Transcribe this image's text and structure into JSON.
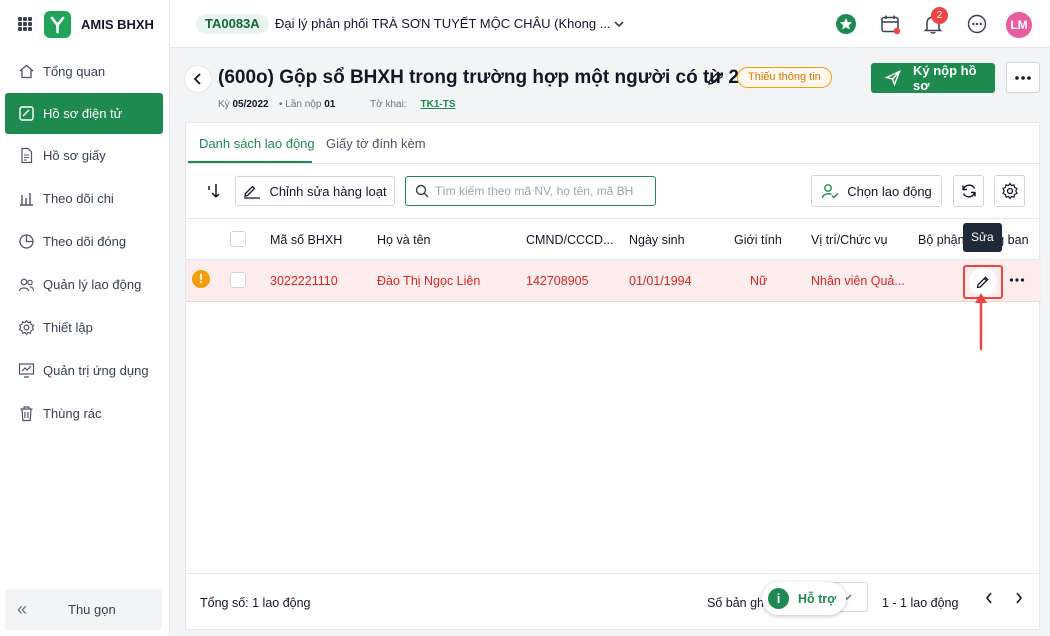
{
  "app": {
    "name": "AMIS BHXH"
  },
  "sidebar": {
    "items": [
      {
        "label": "Tổng quan",
        "icon": "home-icon"
      },
      {
        "label": "Hồ sơ điện tử",
        "icon": "e-file-icon",
        "active": true
      },
      {
        "label": "Hồ sơ giấy",
        "icon": "paper-file-icon"
      },
      {
        "label": "Theo dõi chi",
        "icon": "bar-chart-icon"
      },
      {
        "label": "Theo dõi đóng",
        "icon": "pie-chart-icon"
      },
      {
        "label": "Quản lý lao động",
        "icon": "users-icon"
      },
      {
        "label": "Thiết lập",
        "icon": "settings-icon"
      },
      {
        "label": "Quản trị ứng dụng",
        "icon": "admin-chart-icon"
      },
      {
        "label": "Thùng rác",
        "icon": "trash-icon"
      }
    ],
    "collapse_label": "Thu gọn"
  },
  "topbar": {
    "unit_code": "TA0083A",
    "unit_name": "Đại lý phân phối TRÀ SƠN TUYẾT MỘC CHÂU (Khong ...",
    "notification_count": "2",
    "avatar_initials": "LM"
  },
  "header": {
    "title": "(600o) Gộp sổ BHXH trong trường hợp một người có từ 2 sổ ...",
    "status": "Thiếu thông tin",
    "submit_label": "Ký nộp hồ sơ",
    "period_label": "Kỳ",
    "period_value": "05/2022",
    "attempt_label": "Lần nộp",
    "attempt_value": "01",
    "form_label": "Tờ khai:",
    "form_value": "TK1-TS"
  },
  "tabs": [
    {
      "label": "Danh sách lao động",
      "active": true
    },
    {
      "label": "Giấy tờ đính kèm"
    }
  ],
  "toolbar": {
    "bulk_edit_label": "Chỉnh sửa hàng loạt",
    "search_placeholder": "Tìm kiếm theo mã NV, họ tên, mã BH",
    "choose_label": "Chọn lao động"
  },
  "table": {
    "columns": [
      "Mã số BHXH",
      "Họ và tên",
      "CMND/CCCD...",
      "Ngày sinh",
      "Giới tính",
      "Vị trí/Chức vụ",
      "Bộ phận/Phòng ban"
    ],
    "rows": [
      {
        "bhxh": "3022221110",
        "name": "Đào Thị Ngọc Liên",
        "id_no": "142708905",
        "dob": "01/01/1994",
        "gender": "Nữ",
        "position": "Nhân viên Quả...",
        "department": ""
      }
    ]
  },
  "tooltip": "Sửa",
  "footer": {
    "total": "Tổng số: 1 lao động",
    "page_size_label": "Số bản ghi",
    "range": "1 - 1 lao động"
  },
  "support_label": "Hỗ trợ",
  "colors": {
    "brand": "#1e8a4f",
    "warning": "#f59e0b",
    "error": "#dc2626",
    "annotation": "#ef4444"
  }
}
